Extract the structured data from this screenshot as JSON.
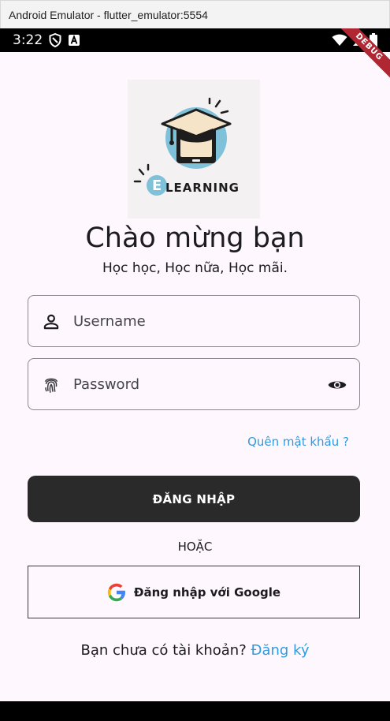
{
  "window": {
    "title": "Android Emulator - flutter_emulator:5554"
  },
  "status_bar": {
    "time": "3:22"
  },
  "debug_banner": {
    "label": "DEBUG"
  },
  "logo": {
    "text": "LEARNING",
    "letter": "E"
  },
  "welcome": {
    "title": "Chào mừng bạn",
    "subtitle": "Học học, Học nữa, Học mãi."
  },
  "form": {
    "username_placeholder": "Username",
    "password_placeholder": "Password",
    "forgot_label": "Quên mật khẩu ?",
    "login_label": "ĐĂNG NHẬP",
    "or_label": "HOẶC",
    "google_label": "Đăng nhập với Google"
  },
  "signup": {
    "prompt": "Bạn chưa có tài khoản?",
    "link": "Đăng ký"
  },
  "colors": {
    "accent": "#2f9be0",
    "primary_button": "#2a2a2a",
    "background": "#fef7fd",
    "logo_circle": "#7fc1d8"
  },
  "icons": [
    "shield-icon",
    "a-icon",
    "wifi-icon",
    "signal-icon",
    "battery-icon",
    "person-icon",
    "fingerprint-icon",
    "eye-icon",
    "google-icon"
  ]
}
